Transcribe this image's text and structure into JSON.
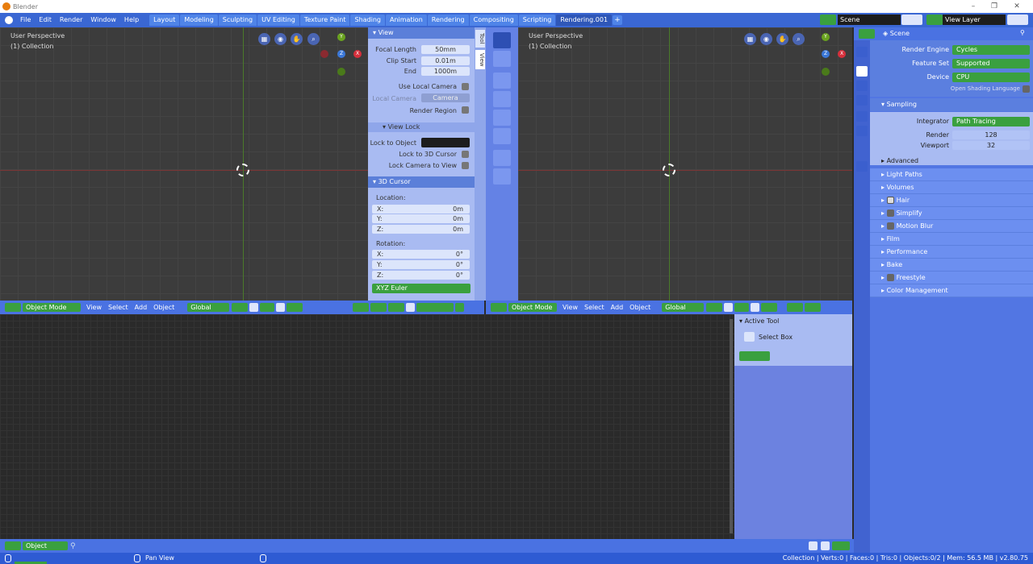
{
  "window": {
    "title": "Blender"
  },
  "menu": [
    "File",
    "Edit",
    "Render",
    "Window",
    "Help"
  ],
  "workspaces": [
    "Layout",
    "Modeling",
    "Sculpting",
    "UV Editing",
    "Texture Paint",
    "Shading",
    "Animation",
    "Rendering",
    "Compositing",
    "Scripting",
    "Rendering.001"
  ],
  "active_workspace": "Rendering.001",
  "scene": {
    "name": "Scene",
    "view_layer": "View Layer"
  },
  "viewport_left": {
    "perspective": "User Perspective",
    "collection": "(1) Collection"
  },
  "viewport_right": {
    "perspective": "User Perspective",
    "collection": "(1) Collection"
  },
  "gizmo": {
    "y": "Y",
    "z": "Z",
    "x": "X"
  },
  "npanel": {
    "tabs": [
      "Tool",
      "View"
    ],
    "view_section": "View",
    "focal_length_label": "Focal Length",
    "focal_length": "50mm",
    "clip_start_label": "Clip Start",
    "clip_start": "0.01m",
    "end_label": "End",
    "end": "1000m",
    "use_local_camera": "Use Local Camera",
    "local_camera_label": "Local Camera",
    "local_camera": "Camera",
    "render_region": "Render Region",
    "view_lock_section": "View Lock",
    "lock_to_object": "Lock to Object",
    "lock_to_3d_cursor": "Lock to 3D Cursor",
    "lock_camera_to_view": "Lock Camera to View",
    "cursor_section": "3D Cursor",
    "location_label": "Location:",
    "loc": [
      {
        "axis": "X:",
        "value": "0m"
      },
      {
        "axis": "Y:",
        "value": "0m"
      },
      {
        "axis": "Z:",
        "value": "0m"
      }
    ],
    "rotation_label": "Rotation:",
    "rot": [
      {
        "axis": "X:",
        "value": "0°"
      },
      {
        "axis": "Y:",
        "value": "0°"
      },
      {
        "axis": "Z:",
        "value": "0°"
      }
    ],
    "rotation_mode": "XYZ Euler"
  },
  "header": {
    "mode": "Object Mode",
    "menus": [
      "View",
      "Select",
      "Add",
      "Object"
    ],
    "transform": "Global"
  },
  "properties": {
    "scene_label": "Scene",
    "render_engine_label": "Render Engine",
    "render_engine": "Cycles",
    "feature_set_label": "Feature Set",
    "feature_set": "Supported",
    "device_label": "Device",
    "device": "CPU",
    "osl_label": "Open Shading Language",
    "sampling": "Sampling",
    "integrator_label": "Integrator",
    "integrator": "Path Tracing",
    "render_label": "Render",
    "render_samples": "128",
    "viewport_label": "Viewport",
    "viewport_samples": "32",
    "advanced": "Advanced",
    "sections": [
      "Light Paths",
      "Volumes",
      "Hair",
      "Simplify",
      "Motion Blur",
      "Film",
      "Performance",
      "Bake",
      "Freestyle",
      "Color Management"
    ]
  },
  "active_tool": {
    "title": "Active Tool",
    "tool": "Select Box"
  },
  "bottom_header": {
    "mode": "Object"
  },
  "status": {
    "hint": "Pan View",
    "stats": "Collection | Verts:0 | Faces:0 | Tris:0 | Objects:0/2 | Mem: 56.5 MB | v2.80.75"
  },
  "colors": {
    "accent": "#4a72e2",
    "green": "#3aa03f",
    "npanel": "#a9bbf2"
  }
}
